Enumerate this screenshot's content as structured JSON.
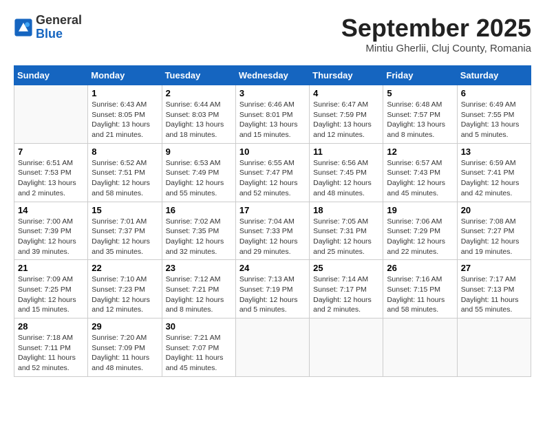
{
  "header": {
    "logo_general": "General",
    "logo_blue": "Blue",
    "month_year": "September 2025",
    "location": "Mintiu Gherlii, Cluj County, Romania"
  },
  "weekdays": [
    "Sunday",
    "Monday",
    "Tuesday",
    "Wednesday",
    "Thursday",
    "Friday",
    "Saturday"
  ],
  "weeks": [
    [
      {
        "day": "",
        "detail": ""
      },
      {
        "day": "1",
        "detail": "Sunrise: 6:43 AM\nSunset: 8:05 PM\nDaylight: 13 hours\nand 21 minutes."
      },
      {
        "day": "2",
        "detail": "Sunrise: 6:44 AM\nSunset: 8:03 PM\nDaylight: 13 hours\nand 18 minutes."
      },
      {
        "day": "3",
        "detail": "Sunrise: 6:46 AM\nSunset: 8:01 PM\nDaylight: 13 hours\nand 15 minutes."
      },
      {
        "day": "4",
        "detail": "Sunrise: 6:47 AM\nSunset: 7:59 PM\nDaylight: 13 hours\nand 12 minutes."
      },
      {
        "day": "5",
        "detail": "Sunrise: 6:48 AM\nSunset: 7:57 PM\nDaylight: 13 hours\nand 8 minutes."
      },
      {
        "day": "6",
        "detail": "Sunrise: 6:49 AM\nSunset: 7:55 PM\nDaylight: 13 hours\nand 5 minutes."
      }
    ],
    [
      {
        "day": "7",
        "detail": "Sunrise: 6:51 AM\nSunset: 7:53 PM\nDaylight: 13 hours\nand 2 minutes."
      },
      {
        "day": "8",
        "detail": "Sunrise: 6:52 AM\nSunset: 7:51 PM\nDaylight: 12 hours\nand 58 minutes."
      },
      {
        "day": "9",
        "detail": "Sunrise: 6:53 AM\nSunset: 7:49 PM\nDaylight: 12 hours\nand 55 minutes."
      },
      {
        "day": "10",
        "detail": "Sunrise: 6:55 AM\nSunset: 7:47 PM\nDaylight: 12 hours\nand 52 minutes."
      },
      {
        "day": "11",
        "detail": "Sunrise: 6:56 AM\nSunset: 7:45 PM\nDaylight: 12 hours\nand 48 minutes."
      },
      {
        "day": "12",
        "detail": "Sunrise: 6:57 AM\nSunset: 7:43 PM\nDaylight: 12 hours\nand 45 minutes."
      },
      {
        "day": "13",
        "detail": "Sunrise: 6:59 AM\nSunset: 7:41 PM\nDaylight: 12 hours\nand 42 minutes."
      }
    ],
    [
      {
        "day": "14",
        "detail": "Sunrise: 7:00 AM\nSunset: 7:39 PM\nDaylight: 12 hours\nand 39 minutes."
      },
      {
        "day": "15",
        "detail": "Sunrise: 7:01 AM\nSunset: 7:37 PM\nDaylight: 12 hours\nand 35 minutes."
      },
      {
        "day": "16",
        "detail": "Sunrise: 7:02 AM\nSunset: 7:35 PM\nDaylight: 12 hours\nand 32 minutes."
      },
      {
        "day": "17",
        "detail": "Sunrise: 7:04 AM\nSunset: 7:33 PM\nDaylight: 12 hours\nand 29 minutes."
      },
      {
        "day": "18",
        "detail": "Sunrise: 7:05 AM\nSunset: 7:31 PM\nDaylight: 12 hours\nand 25 minutes."
      },
      {
        "day": "19",
        "detail": "Sunrise: 7:06 AM\nSunset: 7:29 PM\nDaylight: 12 hours\nand 22 minutes."
      },
      {
        "day": "20",
        "detail": "Sunrise: 7:08 AM\nSunset: 7:27 PM\nDaylight: 12 hours\nand 19 minutes."
      }
    ],
    [
      {
        "day": "21",
        "detail": "Sunrise: 7:09 AM\nSunset: 7:25 PM\nDaylight: 12 hours\nand 15 minutes."
      },
      {
        "day": "22",
        "detail": "Sunrise: 7:10 AM\nSunset: 7:23 PM\nDaylight: 12 hours\nand 12 minutes."
      },
      {
        "day": "23",
        "detail": "Sunrise: 7:12 AM\nSunset: 7:21 PM\nDaylight: 12 hours\nand 8 minutes."
      },
      {
        "day": "24",
        "detail": "Sunrise: 7:13 AM\nSunset: 7:19 PM\nDaylight: 12 hours\nand 5 minutes."
      },
      {
        "day": "25",
        "detail": "Sunrise: 7:14 AM\nSunset: 7:17 PM\nDaylight: 12 hours\nand 2 minutes."
      },
      {
        "day": "26",
        "detail": "Sunrise: 7:16 AM\nSunset: 7:15 PM\nDaylight: 11 hours\nand 58 minutes."
      },
      {
        "day": "27",
        "detail": "Sunrise: 7:17 AM\nSunset: 7:13 PM\nDaylight: 11 hours\nand 55 minutes."
      }
    ],
    [
      {
        "day": "28",
        "detail": "Sunrise: 7:18 AM\nSunset: 7:11 PM\nDaylight: 11 hours\nand 52 minutes."
      },
      {
        "day": "29",
        "detail": "Sunrise: 7:20 AM\nSunset: 7:09 PM\nDaylight: 11 hours\nand 48 minutes."
      },
      {
        "day": "30",
        "detail": "Sunrise: 7:21 AM\nSunset: 7:07 PM\nDaylight: 11 hours\nand 45 minutes."
      },
      {
        "day": "",
        "detail": ""
      },
      {
        "day": "",
        "detail": ""
      },
      {
        "day": "",
        "detail": ""
      },
      {
        "day": "",
        "detail": ""
      }
    ]
  ]
}
